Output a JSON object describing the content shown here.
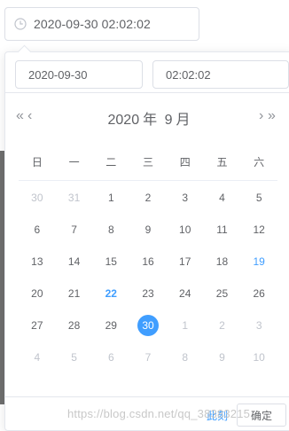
{
  "input": {
    "value": "2020-09-30 02:02:02",
    "icon": "clock-icon"
  },
  "picker": {
    "date_value": "2020-09-30",
    "time_value": "02:02:02",
    "nav": {
      "prev_year": "«",
      "prev_month": "‹",
      "next_month": "›",
      "next_year": "»"
    },
    "year": "2020",
    "year_unit": "年",
    "month": "9",
    "month_unit": "月",
    "weekdays": [
      "日",
      "一",
      "二",
      "三",
      "四",
      "五",
      "六"
    ],
    "weeks": [
      [
        {
          "d": "30",
          "t": "other"
        },
        {
          "d": "31",
          "t": "other"
        },
        {
          "d": "1",
          "t": "cur"
        },
        {
          "d": "2",
          "t": "cur"
        },
        {
          "d": "3",
          "t": "cur"
        },
        {
          "d": "4",
          "t": "cur"
        },
        {
          "d": "5",
          "t": "cur"
        }
      ],
      [
        {
          "d": "6",
          "t": "cur"
        },
        {
          "d": "7",
          "t": "cur"
        },
        {
          "d": "8",
          "t": "cur"
        },
        {
          "d": "9",
          "t": "cur"
        },
        {
          "d": "10",
          "t": "cur"
        },
        {
          "d": "11",
          "t": "cur"
        },
        {
          "d": "12",
          "t": "cur"
        }
      ],
      [
        {
          "d": "13",
          "t": "cur"
        },
        {
          "d": "14",
          "t": "cur"
        },
        {
          "d": "15",
          "t": "cur"
        },
        {
          "d": "16",
          "t": "cur"
        },
        {
          "d": "17",
          "t": "cur"
        },
        {
          "d": "18",
          "t": "cur"
        },
        {
          "d": "19",
          "t": "weekend"
        }
      ],
      [
        {
          "d": "20",
          "t": "cur"
        },
        {
          "d": "21",
          "t": "cur"
        },
        {
          "d": "22",
          "t": "today"
        },
        {
          "d": "23",
          "t": "cur"
        },
        {
          "d": "24",
          "t": "cur"
        },
        {
          "d": "25",
          "t": "cur"
        },
        {
          "d": "26",
          "t": "cur"
        }
      ],
      [
        {
          "d": "27",
          "t": "cur"
        },
        {
          "d": "28",
          "t": "cur"
        },
        {
          "d": "29",
          "t": "cur"
        },
        {
          "d": "30",
          "t": "selected"
        },
        {
          "d": "1",
          "t": "other"
        },
        {
          "d": "2",
          "t": "other"
        },
        {
          "d": "3",
          "t": "other"
        }
      ],
      [
        {
          "d": "4",
          "t": "other"
        },
        {
          "d": "5",
          "t": "other"
        },
        {
          "d": "6",
          "t": "other"
        },
        {
          "d": "7",
          "t": "other"
        },
        {
          "d": "8",
          "t": "other"
        },
        {
          "d": "9",
          "t": "other"
        },
        {
          "d": "10",
          "t": "other"
        }
      ]
    ],
    "footer": {
      "now_label": "此刻",
      "confirm_label": "确定"
    }
  },
  "watermark": "https://blog.csdn.net/qq_38383215",
  "colors": {
    "accent": "#409eff",
    "text": "#606266",
    "muted": "#c0c4cc",
    "border": "#dcdfe6"
  }
}
